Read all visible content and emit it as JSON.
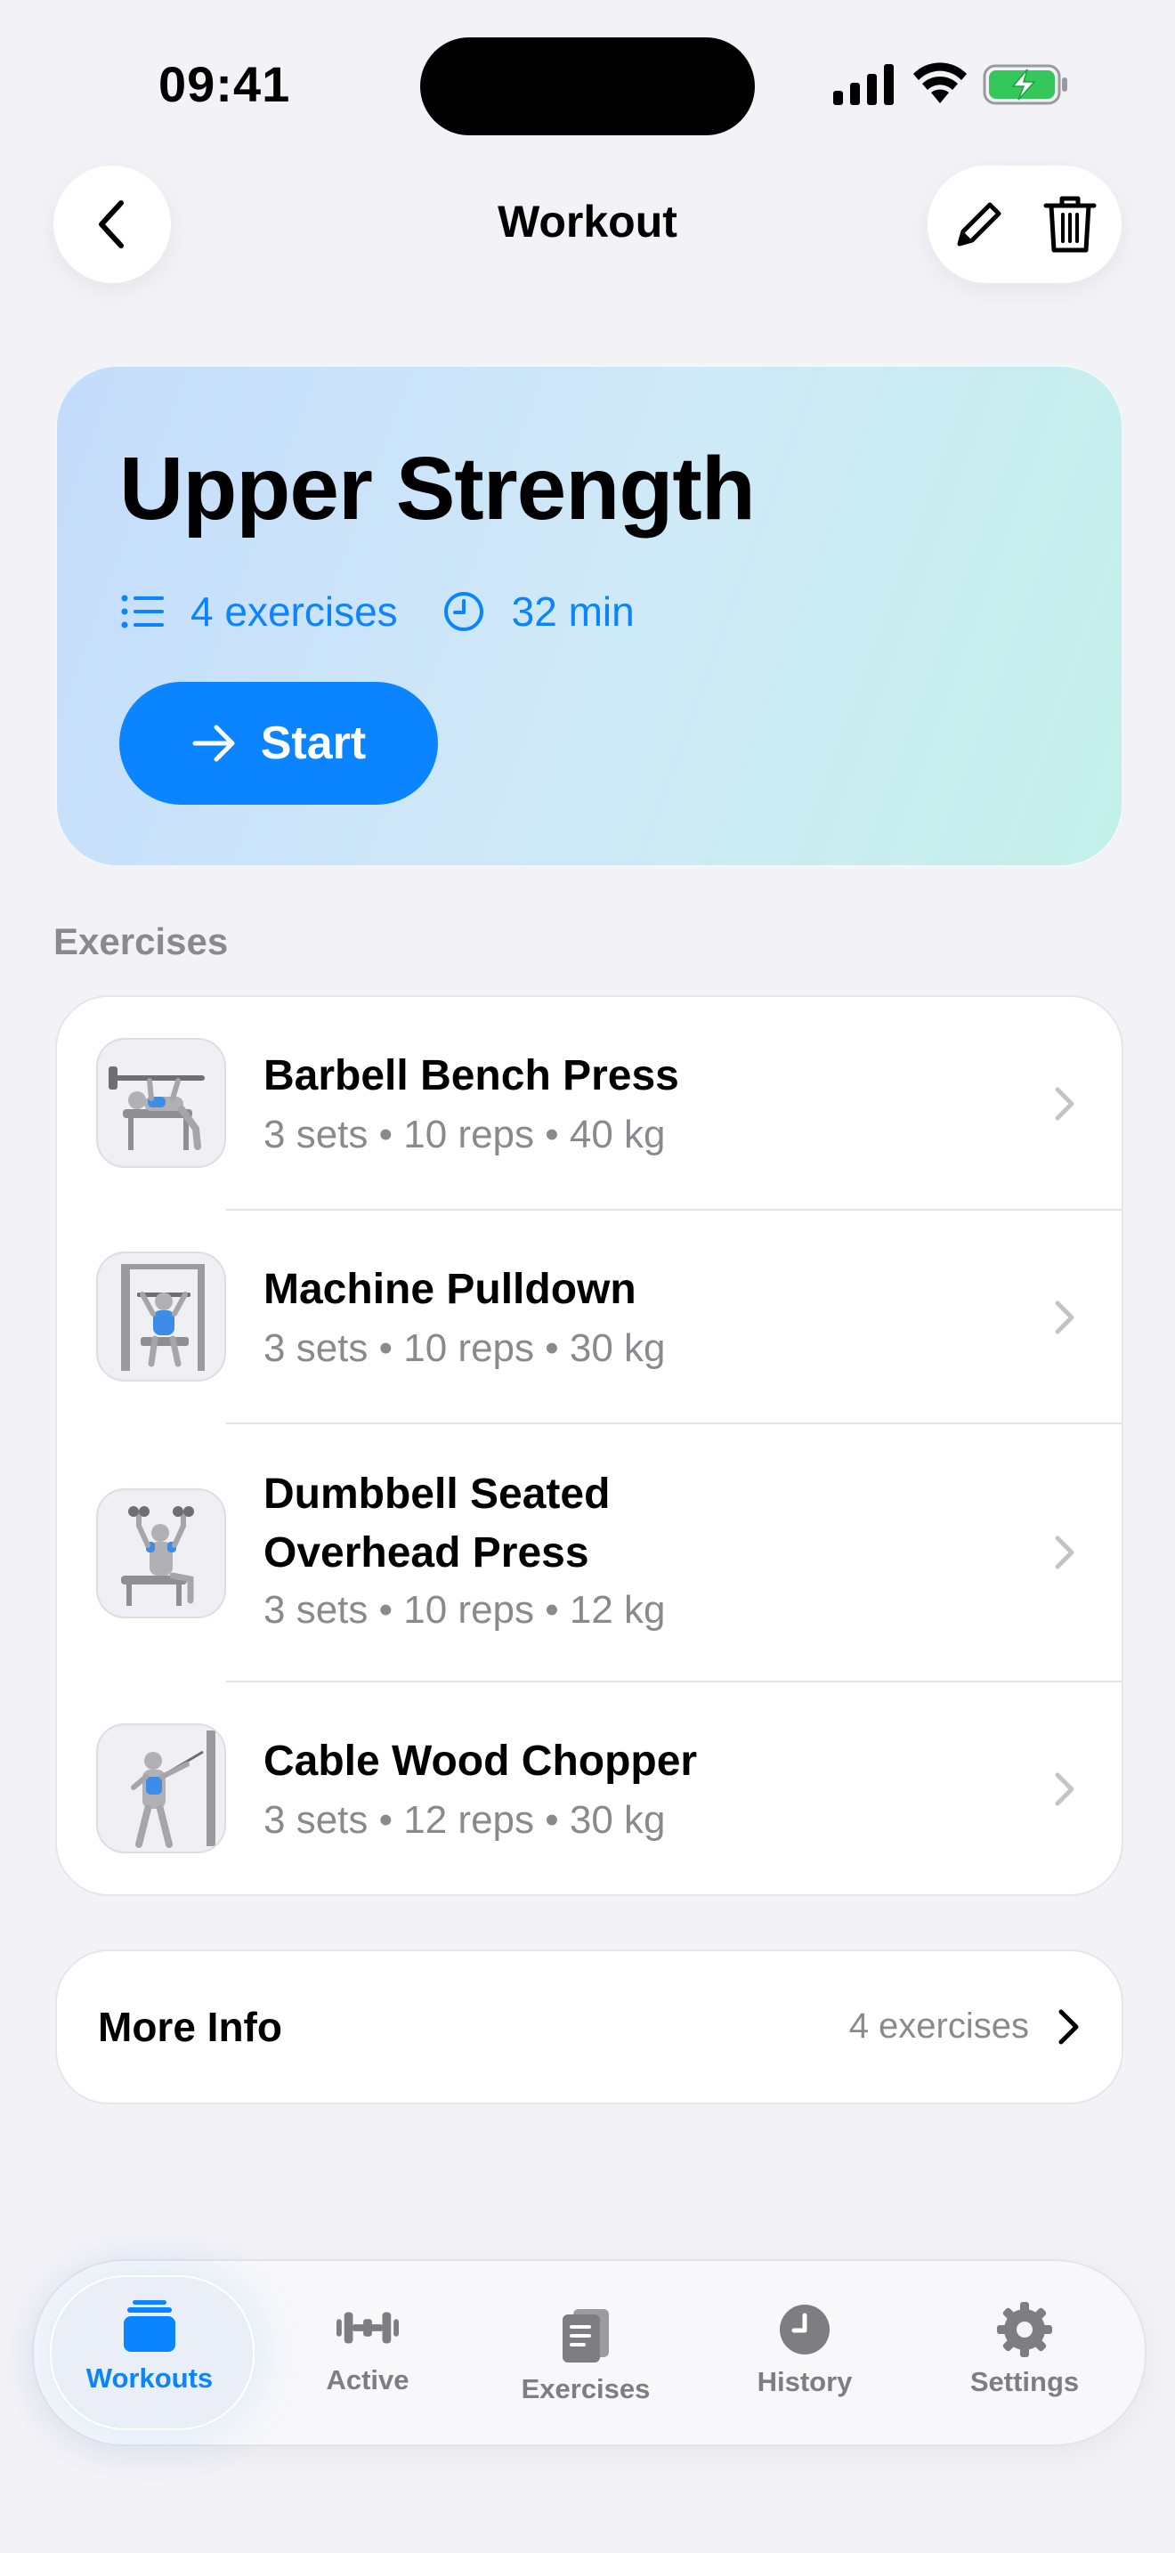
{
  "status_bar": {
    "time": "09:41"
  },
  "nav": {
    "title": "Workout"
  },
  "workout": {
    "name": "Upper Strength",
    "exercise_count": "4 exercises",
    "duration": "32 min",
    "start_label": "Start"
  },
  "section": {
    "exercises_label": "Exercises"
  },
  "exercises": [
    {
      "name": "Barbell Bench Press",
      "detail": "3 sets • 10 reps • 40 kg"
    },
    {
      "name": "Machine Pulldown",
      "detail": "3 sets • 10 reps • 30 kg"
    },
    {
      "name": "Dumbbell Seated Overhead Press",
      "detail": "3 sets • 10 reps • 12 kg"
    },
    {
      "name": "Cable Wood Chopper",
      "detail": "3 sets • 12 reps • 30 kg"
    }
  ],
  "more_info": {
    "label": "More Info",
    "value": "4 exercises"
  },
  "tabs": [
    {
      "label": "Workouts",
      "icon": "stack-icon",
      "active": true
    },
    {
      "label": "Active",
      "icon": "dumbbell-icon",
      "active": false
    },
    {
      "label": "Exercises",
      "icon": "book-icon",
      "active": false
    },
    {
      "label": "History",
      "icon": "clock-icon",
      "active": false
    },
    {
      "label": "Settings",
      "icon": "gear-icon",
      "active": false
    }
  ],
  "colors": {
    "accent": "#0a84ff",
    "background": "#f2f2f7",
    "muscle_highlight": "#3d8de8"
  }
}
